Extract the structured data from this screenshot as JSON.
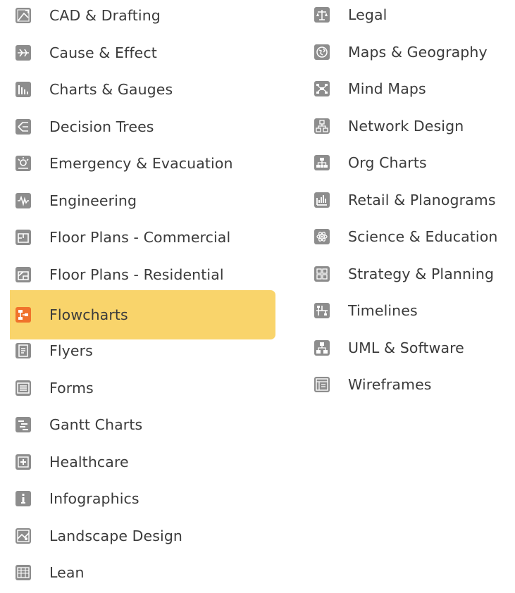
{
  "left_column": [
    {
      "label": "CAD & Drafting",
      "icon": "cad-drafting-icon"
    },
    {
      "label": "Cause & Effect",
      "icon": "cause-effect-icon"
    },
    {
      "label": "Charts & Gauges",
      "icon": "bar-chart-icon"
    },
    {
      "label": "Decision Trees",
      "icon": "decision-tree-icon"
    },
    {
      "label": "Emergency & Evacuation",
      "icon": "emergency-icon"
    },
    {
      "label": "Engineering",
      "icon": "waveform-icon"
    },
    {
      "label": "Floor Plans - Commercial",
      "icon": "floor-plan-commercial-icon"
    },
    {
      "label": "Floor Plans - Residential",
      "icon": "floor-plan-residential-icon"
    },
    {
      "label": "Flowcharts",
      "icon": "flowchart-icon",
      "selected": true
    },
    {
      "label": "Flyers",
      "icon": "flyer-icon"
    },
    {
      "label": "Forms",
      "icon": "form-icon"
    },
    {
      "label": "Gantt Charts",
      "icon": "gantt-icon"
    },
    {
      "label": "Healthcare",
      "icon": "healthcare-plus-icon"
    },
    {
      "label": "Infographics",
      "icon": "info-icon"
    },
    {
      "label": "Landscape Design",
      "icon": "landscape-icon"
    },
    {
      "label": "Lean",
      "icon": "lean-grid-icon"
    }
  ],
  "right_column": [
    {
      "label": "Legal",
      "icon": "scales-icon"
    },
    {
      "label": "Maps & Geography",
      "icon": "globe-icon"
    },
    {
      "label": "Mind Maps",
      "icon": "mind-map-icon"
    },
    {
      "label": "Network Design",
      "icon": "network-icon"
    },
    {
      "label": "Org Charts",
      "icon": "org-chart-icon"
    },
    {
      "label": "Retail & Planograms",
      "icon": "planogram-icon"
    },
    {
      "label": "Science & Education",
      "icon": "atom-icon"
    },
    {
      "label": "Strategy & Planning",
      "icon": "strategy-icon"
    },
    {
      "label": "Timelines",
      "icon": "timeline-icon"
    },
    {
      "label": "UML & Software",
      "icon": "uml-icon"
    },
    {
      "label": "Wireframes",
      "icon": "wireframe-icon"
    }
  ],
  "colors": {
    "selected_background": "#f9d46b",
    "selected_icon": "#f0722b",
    "icon_gray": "#8d8d8d",
    "text": "#3b3b3b"
  }
}
